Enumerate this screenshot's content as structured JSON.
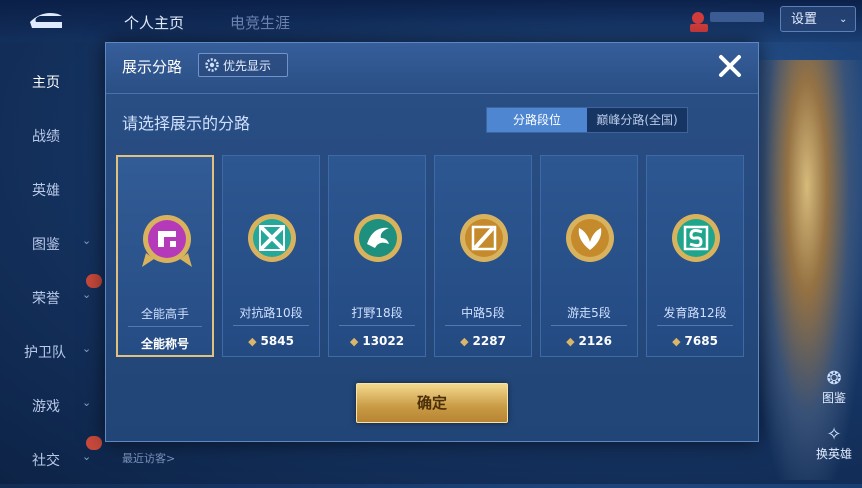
{
  "top_tabs": [
    "个人主页",
    "电竞生涯"
  ],
  "settings_label": "设置",
  "sidebar": {
    "items": [
      {
        "label": "主页",
        "chevron": false,
        "new": false
      },
      {
        "label": "战绩",
        "chevron": false,
        "new": false
      },
      {
        "label": "英雄",
        "chevron": false,
        "new": false
      },
      {
        "label": "图鉴",
        "chevron": true,
        "new": false
      },
      {
        "label": "荣誉",
        "chevron": true,
        "new": true
      },
      {
        "label": "护卫队",
        "chevron": true,
        "new": false
      },
      {
        "label": "游戏",
        "chevron": true,
        "new": false
      },
      {
        "label": "社交",
        "chevron": true,
        "new": true
      }
    ]
  },
  "right_buttons": {
    "top": "图鉴",
    "bottom": "换英雄"
  },
  "bottom_visit": "最近访客>",
  "modal": {
    "title": "展示分路",
    "priority_label": "优先显示",
    "subtitle": "请选择展示的分路",
    "segments": [
      "分路段位",
      "巅峰分路(全国)"
    ],
    "cards": [
      {
        "name": "全能高手",
        "score": "全能称号",
        "emblem": "allround-emblem",
        "color": "#b43ab9"
      },
      {
        "name": "对抗路10段",
        "score": "5845",
        "emblem": "clash-lane-emblem",
        "color": "#23a89a"
      },
      {
        "name": "打野18段",
        "score": "13022",
        "emblem": "jungle-emblem",
        "color": "#1f8f7e"
      },
      {
        "name": "中路5段",
        "score": "2287",
        "emblem": "mid-lane-emblem",
        "color": "#c58a2c"
      },
      {
        "name": "游走5段",
        "score": "2126",
        "emblem": "roam-emblem",
        "color": "#c58a2c"
      },
      {
        "name": "发育路12段",
        "score": "7685",
        "emblem": "farm-lane-emblem",
        "color": "#1fa58c"
      }
    ],
    "confirm_label": "确定"
  },
  "colors": {
    "accent_gold": "#e0c27e",
    "panel": "#2a4f85",
    "segment_active": "#4e86d1"
  }
}
